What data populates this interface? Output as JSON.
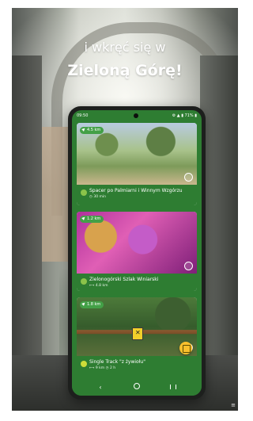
{
  "tagline": {
    "line1": "i wkręć się w",
    "line2": "Zieloną Górę!"
  },
  "status_bar": {
    "time": "09:50",
    "icons": "⚙ ▲ ▮ 71% ▮"
  },
  "cards": [
    {
      "distance": "4.5 km",
      "title": "Spacer po Palmiarni i Winnym Wzgórzu",
      "meta": "◷ 30 min",
      "meta2": ""
    },
    {
      "distance": "1.2 km",
      "title": "Zielonogórski Szlak Winiarski",
      "meta": "⟷ 4.8 km",
      "meta2": ""
    },
    {
      "distance": "1.8 km",
      "title": "Single Track \"z żywiołu\"",
      "meta": "⟷ 9 km  ◷ 2 h",
      "meta2": ""
    }
  ],
  "sign_letter": "✕",
  "nav": {
    "back": "‹"
  },
  "footer": {
    "brand": "≡"
  },
  "colors": {
    "accent": "#2e7d32",
    "fab": "#fbc02d",
    "badge": "#8bc34a"
  }
}
